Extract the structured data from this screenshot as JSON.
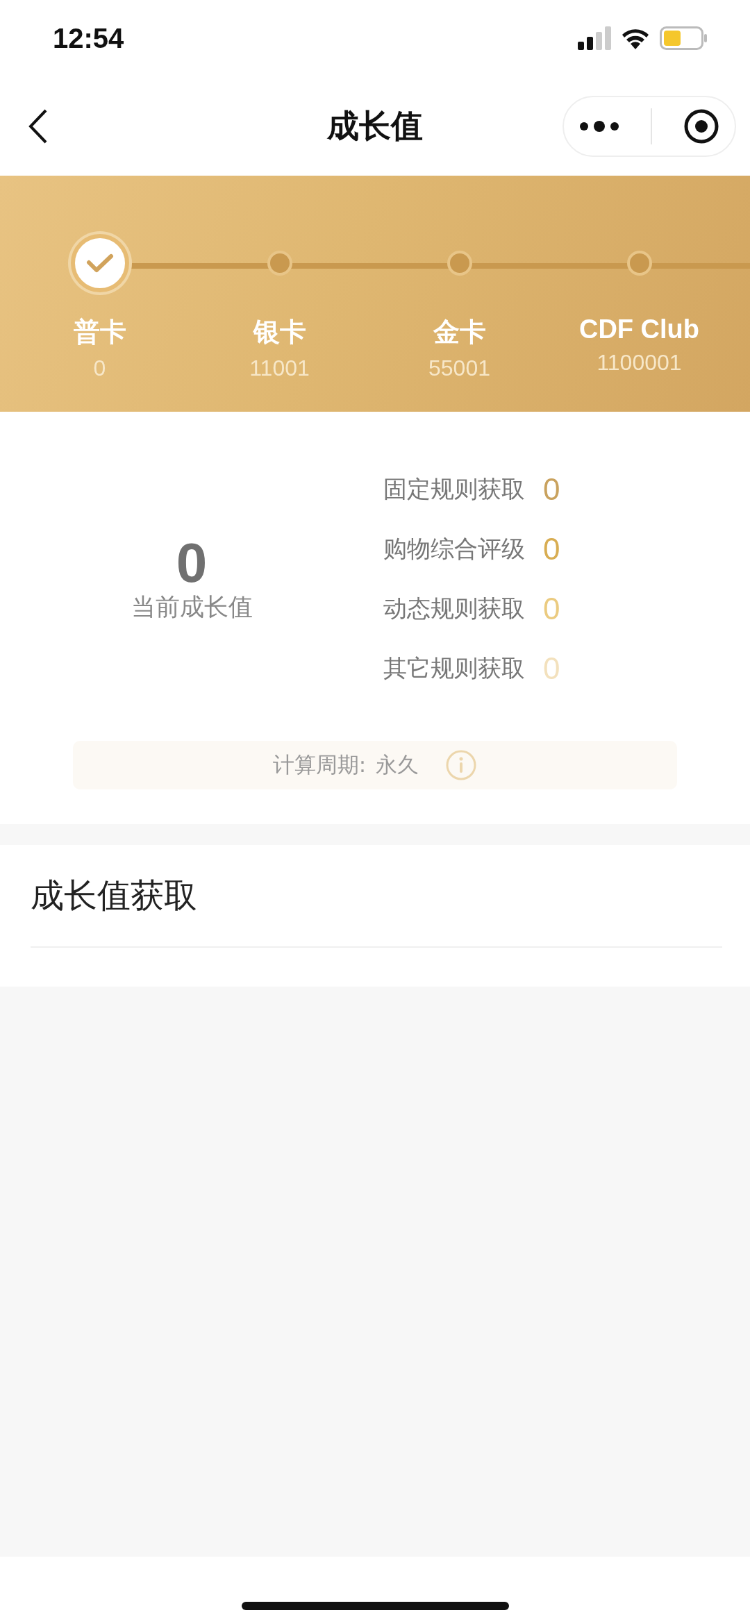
{
  "status_bar": {
    "time": "12:54"
  },
  "nav": {
    "title": "成长值"
  },
  "tiers": [
    {
      "name": "普卡",
      "threshold": "0",
      "reached": true
    },
    {
      "name": "银卡",
      "threshold": "11001",
      "reached": false
    },
    {
      "name": "金卡",
      "threshold": "55001",
      "reached": false
    },
    {
      "name": "CDF Club",
      "threshold": "1100001",
      "reached": false
    }
  ],
  "current": {
    "value": "0",
    "label": "当前成长值"
  },
  "breakdown": [
    {
      "label": "固定规则获取",
      "value": "0",
      "color": "#c9a25e"
    },
    {
      "label": "购物综合评级",
      "value": "0",
      "color": "#d8ad52"
    },
    {
      "label": "动态规则获取",
      "value": "0",
      "color": "#ebcb80"
    },
    {
      "label": "其它规则获取",
      "value": "0",
      "color": "#f3e1bd"
    }
  ],
  "period": {
    "label": "计算周期:",
    "value": "永久"
  },
  "section": {
    "title": "成长值获取"
  }
}
